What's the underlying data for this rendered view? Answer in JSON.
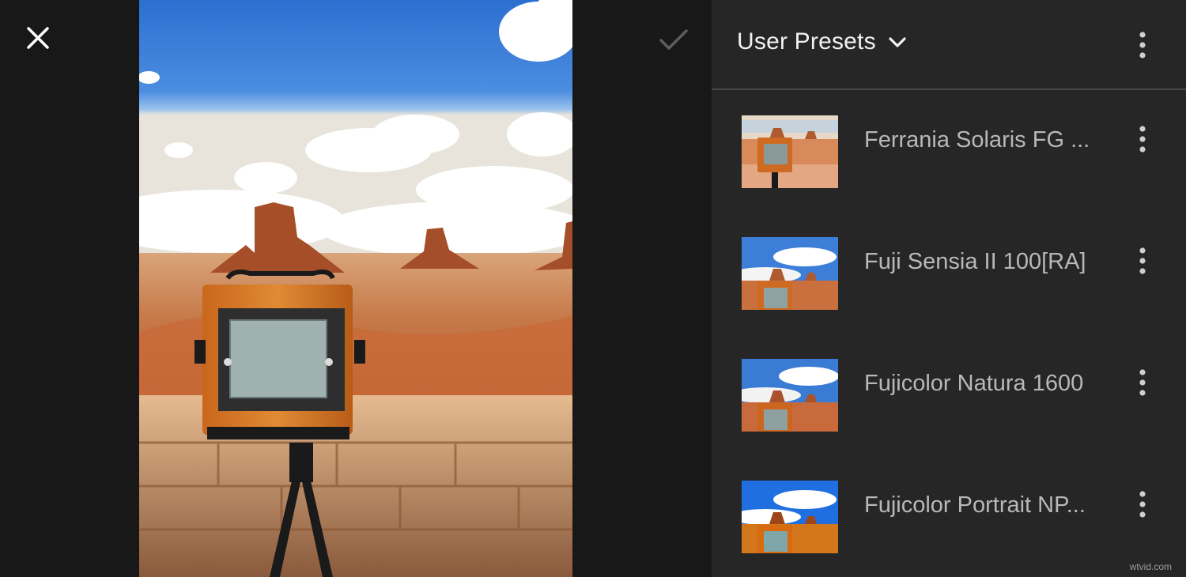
{
  "toolbar": {
    "close_icon": "close-icon",
    "confirm_icon": "check-icon"
  },
  "presets_panel": {
    "title": "User Presets",
    "title_icon": "chevron-down-icon",
    "menu_icon": "more-vertical-icon",
    "items": [
      {
        "label": "Ferrania Solaris FG ...",
        "thumb_tone": "warm"
      },
      {
        "label": "Fuji Sensia II 100[RA]",
        "thumb_tone": "cool"
      },
      {
        "label": "Fujicolor Natura 1600",
        "thumb_tone": "cool"
      },
      {
        "label": "Fujicolor Portrait NP...",
        "thumb_tone": "vivid"
      }
    ]
  },
  "watermark": "wtvid.com",
  "colors": {
    "panel_bg": "#262626",
    "left_bg": "#181818",
    "title_text": "#f2f2f2",
    "item_text": "#b8b8b8"
  }
}
